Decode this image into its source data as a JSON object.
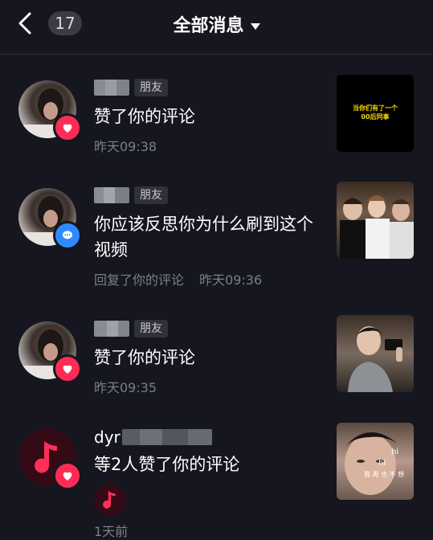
{
  "header": {
    "back_icon": "chevron-left-icon",
    "unread_count": "17",
    "title": "全部消息",
    "dropdown_icon": "caret-down-icon"
  },
  "messages": [
    {
      "name_tag": "朋友",
      "text": "赞了你的评论",
      "time": "昨天09:38",
      "badge_icon": "heart-icon",
      "badge_color": "#fe2c55",
      "thumb_text": [
        "当你们有了一个",
        "00后同事"
      ]
    },
    {
      "name_tag": "朋友",
      "text": "你应该反思你为什么刷到这个视频",
      "meta_prefix": "回复了你的评论",
      "time": "昨天09:36",
      "badge_icon": "comment-icon",
      "badge_color": "#2e8bff"
    },
    {
      "name_tag": "朋友",
      "text": "赞了你的评论",
      "time": "昨天09:35",
      "badge_icon": "heart-icon",
      "badge_color": "#fe2c55"
    },
    {
      "name": "dyr",
      "text": "等2人赞了你的评论",
      "time": "1天前",
      "badge_icon": "heart-icon",
      "badge_color": "#fe2c55",
      "avatar_icon": "music-note-icon",
      "thumb_text": [
        "hi",
        "hi",
        "我 再 也 不 想"
      ]
    }
  ]
}
